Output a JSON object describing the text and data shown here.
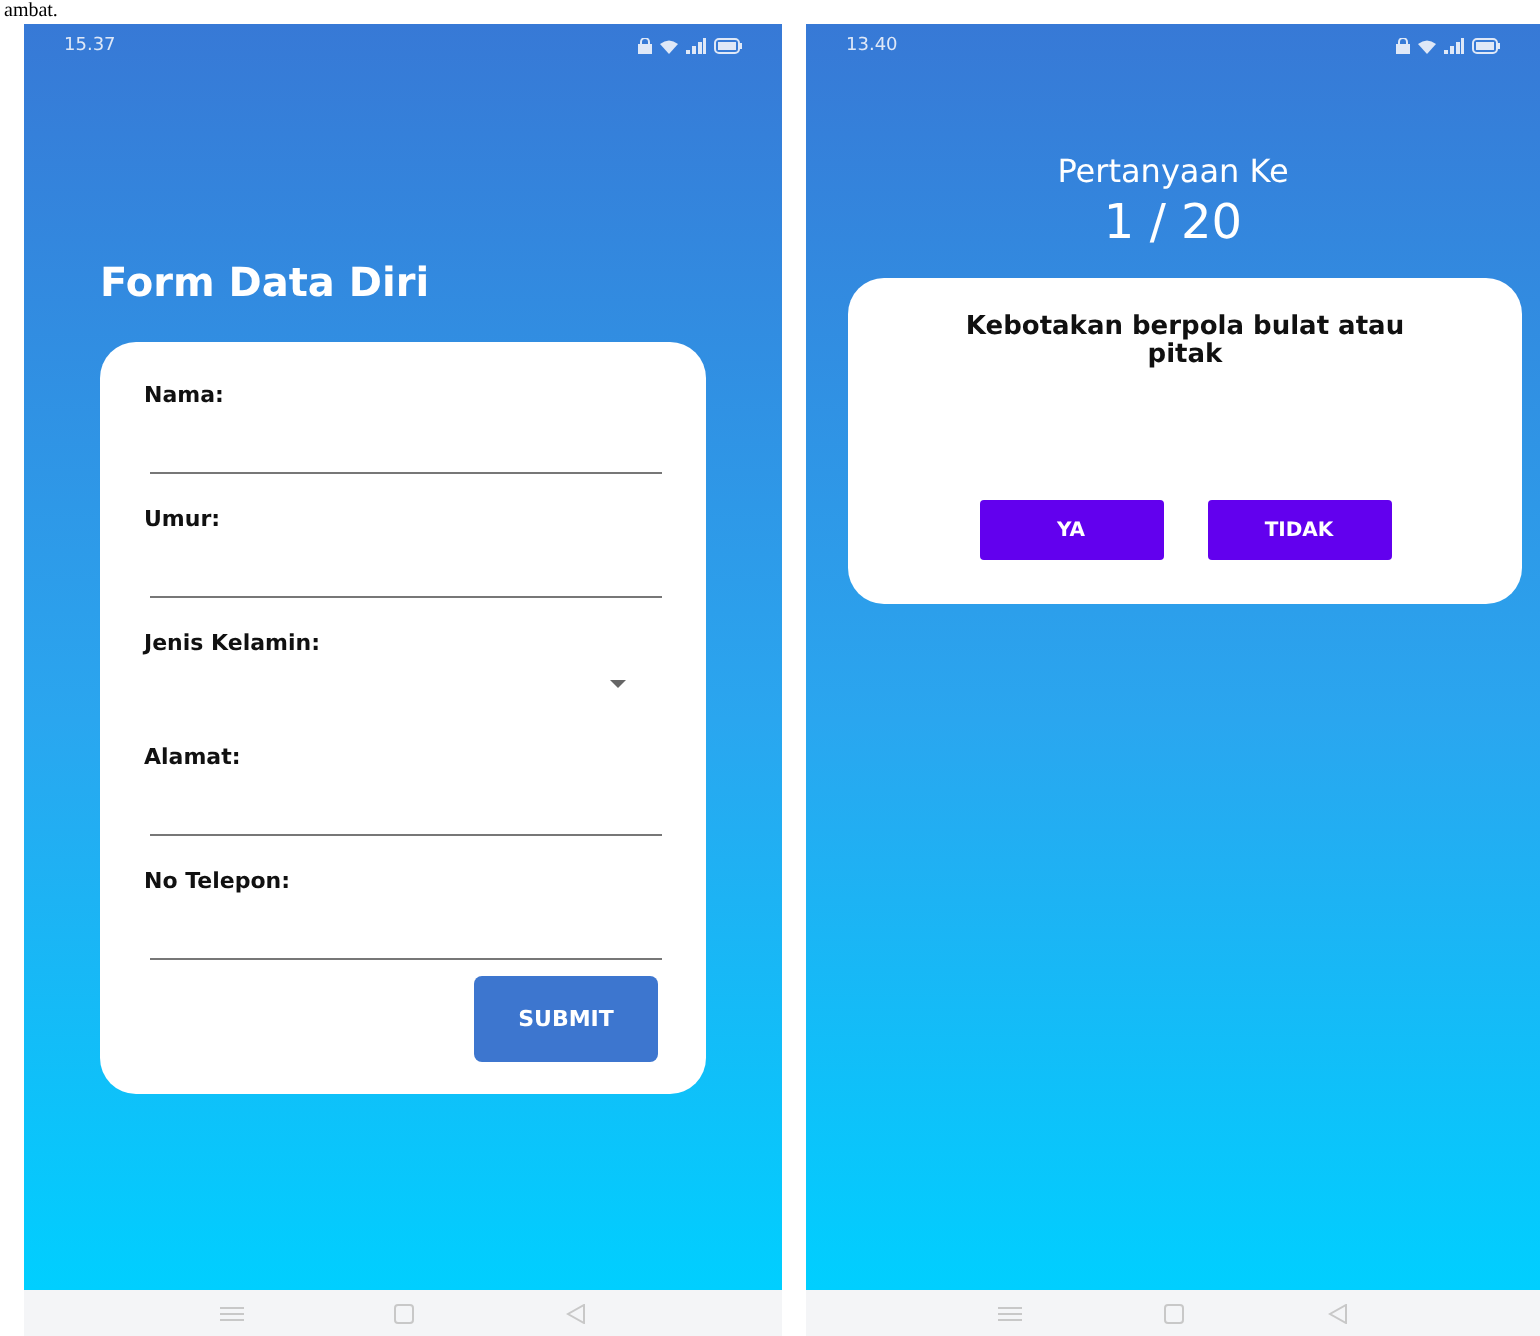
{
  "document_text": "ambat.",
  "form_screen": {
    "time": "15.37",
    "title": "Form Data Diri",
    "fields": [
      {
        "label": "Nama:",
        "kind": "text"
      },
      {
        "label": "Umur:",
        "kind": "text"
      },
      {
        "label": "Jenis Kelamin:",
        "kind": "dropdown"
      },
      {
        "label": "Alamat:",
        "kind": "text"
      },
      {
        "label": "No Telepon:",
        "kind": "text"
      }
    ],
    "submit": "SUBMIT"
  },
  "quiz_screen": {
    "time": "13.40",
    "heading": "Pertanyaan Ke",
    "counter": "1 / 20",
    "question": "Kebotakan berpola bulat atau pitak",
    "answers": [
      "YA",
      "TIDAK"
    ]
  }
}
